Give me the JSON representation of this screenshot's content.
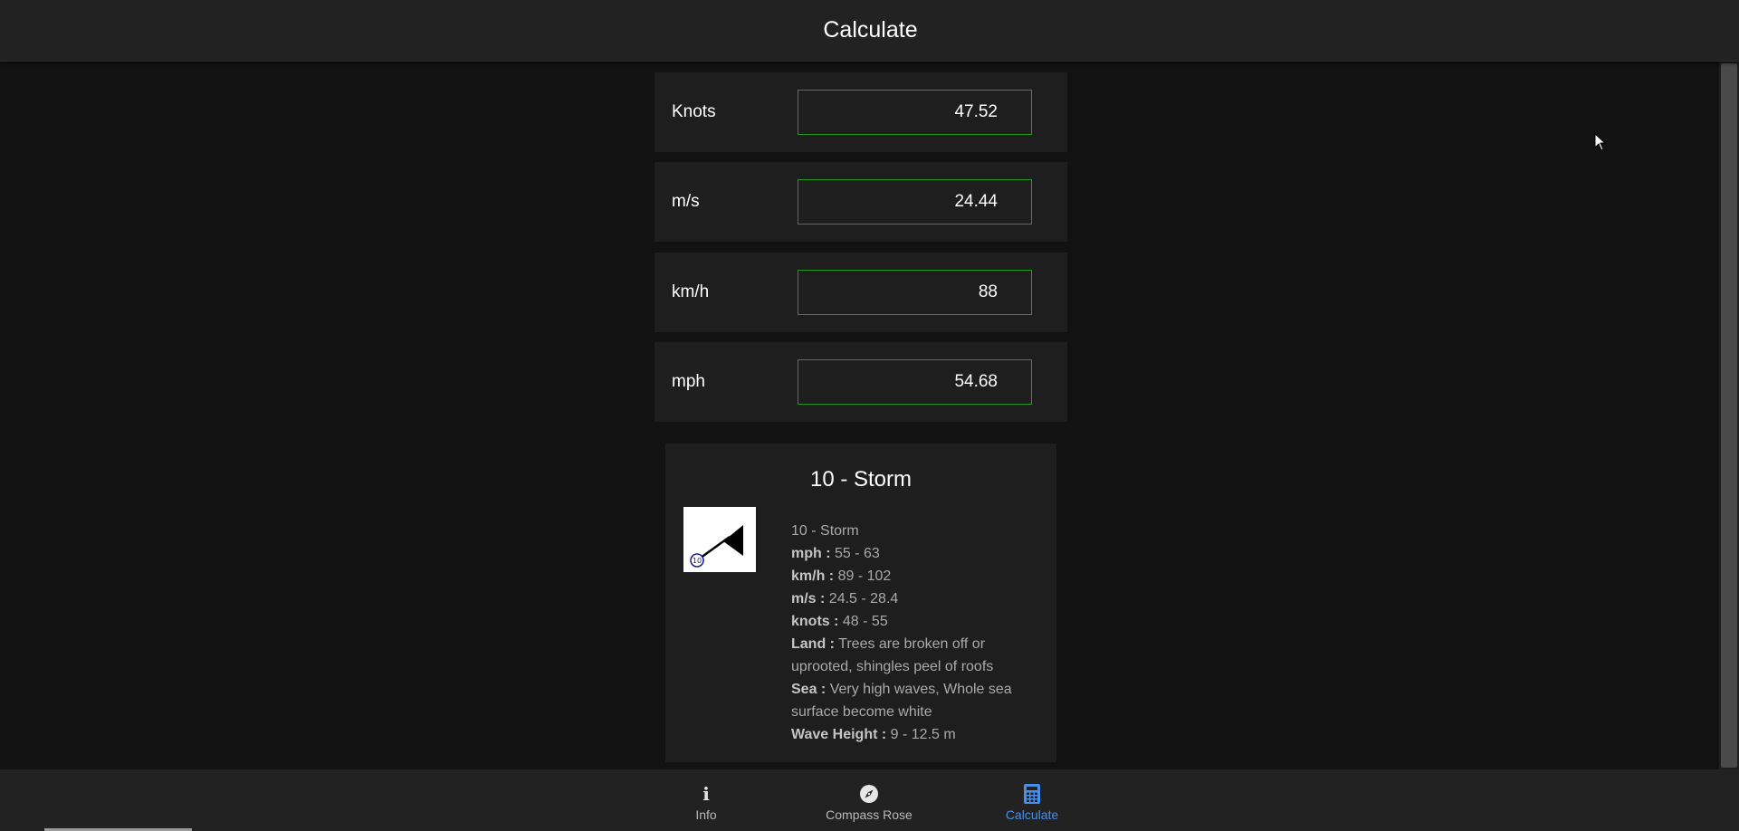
{
  "header": {
    "title": "Calculate"
  },
  "units": [
    {
      "label": "Knots",
      "value": "47.52"
    },
    {
      "label": "m/s",
      "value": "24.44"
    },
    {
      "label": "km/h",
      "value": "88"
    },
    {
      "label": "mph",
      "value": "54.68"
    }
  ],
  "beaufort": {
    "title": "10 - Storm",
    "symbol_badge": "10",
    "heading": "10 - Storm",
    "mph_label": "mph :",
    "mph_value": "55 - 63",
    "kmh_label": "km/h :",
    "kmh_value": "89 - 102",
    "ms_label": "m/s :",
    "ms_value": "24.5 - 28.4",
    "knots_label": "knots :",
    "knots_value": "48 - 55",
    "land_label": "Land :",
    "land_value": "Trees are broken off or uprooted, shingles peel of roofs",
    "sea_label": "Sea :",
    "sea_value": "Very high waves, Whole sea surface become white",
    "wave_label": "Wave Height :",
    "wave_value": "9 - 12.5 m"
  },
  "nav": {
    "items": [
      {
        "label": "Info",
        "icon": "info-icon"
      },
      {
        "label": "Compass Rose",
        "icon": "compass-icon"
      },
      {
        "label": "Calculate",
        "icon": "calculator-icon",
        "active": true
      }
    ]
  },
  "colors": {
    "accent": "#4a8fe7",
    "input_border": "#1e9a1e",
    "background": "#121212",
    "surface": "#1e1e1e"
  }
}
